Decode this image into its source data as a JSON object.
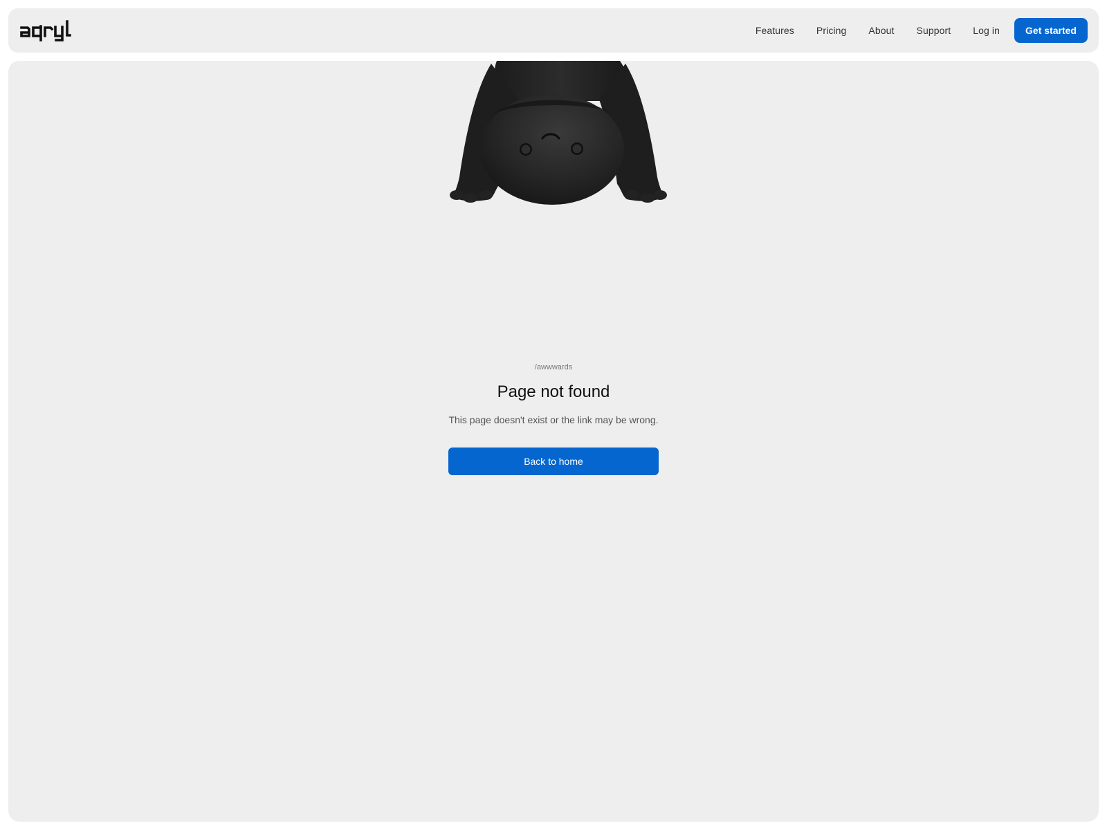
{
  "brand": {
    "logo_text": "aqryl",
    "accent_color": "#0566cf",
    "panel_color": "#eeeeee"
  },
  "nav": {
    "links": [
      {
        "label": "Features"
      },
      {
        "label": "Pricing"
      },
      {
        "label": "About"
      },
      {
        "label": "Support"
      },
      {
        "label": "Log in"
      }
    ],
    "cta_label": "Get started"
  },
  "hero": {
    "mascot_icon": "upside-down-black-creature-illustration"
  },
  "error": {
    "path": "/awwwards",
    "title": "Page not found",
    "message": "This page doesn't exist or the link may be wrong.",
    "button_label": "Back to home"
  }
}
